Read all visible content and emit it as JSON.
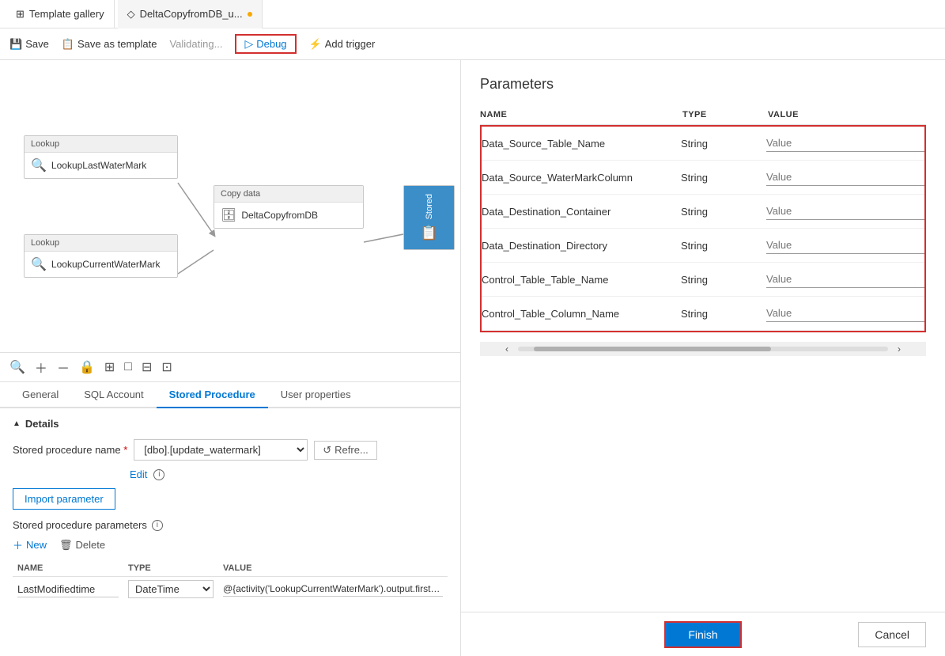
{
  "tabs": {
    "gallery_tab": {
      "label": "Template gallery",
      "icon": "⊞"
    },
    "pipeline_tab": {
      "label": "DeltaCopyfromDB_u...",
      "icon": "◇",
      "dot": true
    }
  },
  "toolbar": {
    "save_label": "Save",
    "save_as_template_label": "Save as template",
    "validating_label": "Validating...",
    "debug_label": "Debug",
    "add_trigger_label": "Add trigger"
  },
  "canvas": {
    "nodes": {
      "lookup1": {
        "header": "Lookup",
        "body": "LookupLastWaterMark"
      },
      "lookup2": {
        "header": "Lookup",
        "body": "LookupCurrentWaterMark"
      },
      "copy": {
        "header": "Copy data",
        "body": "DeltaCopyfromDB"
      },
      "stored": {
        "label": "Stored"
      }
    },
    "tools": [
      "🔍",
      "＋",
      "－",
      "🔒",
      "⊞",
      "□",
      "⊟",
      "⊡"
    ]
  },
  "bottom_tabs": {
    "tabs": [
      {
        "label": "General",
        "active": false
      },
      {
        "label": "SQL Account",
        "active": false
      },
      {
        "label": "Stored Procedure",
        "active": true
      },
      {
        "label": "User properties",
        "active": false
      }
    ]
  },
  "stored_procedure": {
    "section_label": "Details",
    "proc_name_label": "Stored procedure name",
    "proc_name_value": "[dbo].[update_watermark]",
    "edit_label": "Edit",
    "import_btn_label": "Import parameter",
    "params_section_label": "Stored procedure parameters",
    "new_btn_label": "New",
    "delete_btn_label": "Delete",
    "table_headers": {
      "name": "NAME",
      "type": "TYPE",
      "value": "VALUE"
    },
    "params_row": {
      "name": "LastModifiedtime",
      "type": "DateTime",
      "value": "@{activity('LookupCurrentWaterMark').output.firstRow.NewWatermarkValue}"
    }
  },
  "right_panel": {
    "title": "Parameters",
    "columns": {
      "name": "NAME",
      "type": "TYPE",
      "value": "VALUE"
    },
    "params": [
      {
        "name": "Data_Source_Table_Name",
        "type": "String",
        "value": "Value"
      },
      {
        "name": "Data_Source_WaterMarkColumn",
        "type": "String",
        "value": "Value"
      },
      {
        "name": "Data_Destination_Container",
        "type": "String",
        "value": "Value"
      },
      {
        "name": "Data_Destination_Directory",
        "type": "String",
        "value": "Value"
      },
      {
        "name": "Control_Table_Table_Name",
        "type": "String",
        "value": "Value"
      },
      {
        "name": "Control_Table_Column_Name",
        "type": "String",
        "value": "Value"
      }
    ],
    "finish_btn": "Finish",
    "cancel_btn": "Cancel"
  }
}
